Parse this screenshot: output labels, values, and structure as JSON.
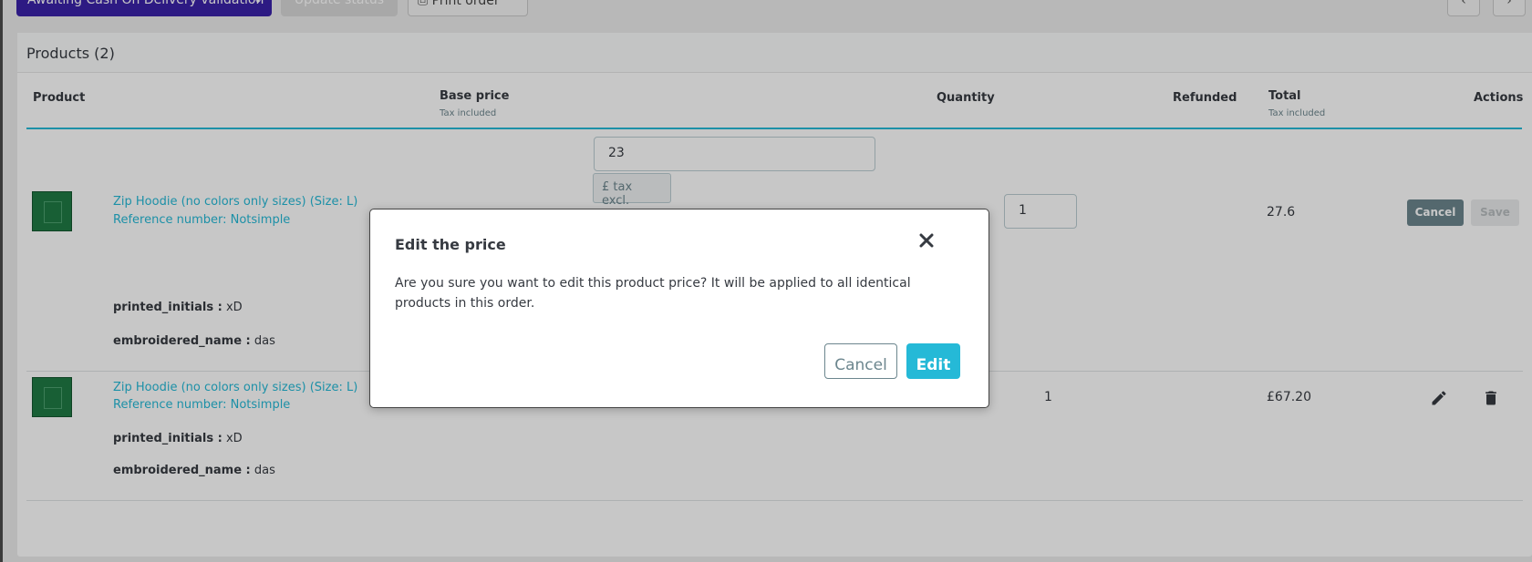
{
  "topbar": {
    "status_select": "Awaiting Cash On Delivery validation",
    "update_status": "Update status",
    "print_order": "Print order",
    "prev": "‹",
    "next": "›"
  },
  "products_card": {
    "title": "Products (2)",
    "columns": {
      "product": "Product",
      "base_price": "Base price",
      "base_price_sub": "Tax included",
      "quantity": "Quantity",
      "refunded": "Refunded",
      "total": "Total",
      "total_sub": "Tax included",
      "actions": "Actions"
    },
    "rows": [
      {
        "name": "Zip Hoodie (no colors only sizes) (Size: L)",
        "reference": "Reference number: Notsimple",
        "price_input": "23",
        "tax_addon": "£ tax excl.",
        "quantity_input": "1",
        "total": "27.6",
        "cancel": "Cancel",
        "save": "Save",
        "custom": [
          {
            "label": "printed_initials :",
            "value": "xD"
          },
          {
            "label": "embroidered_name :",
            "value": "das"
          }
        ]
      },
      {
        "name": "Zip Hoodie (no colors only sizes) (Size: L)",
        "reference": "Reference number: Notsimple",
        "quantity": "1",
        "total": "£67.20",
        "custom": [
          {
            "label": "printed_initials :",
            "value": "xD"
          },
          {
            "label": "embroidered_name :",
            "value": "das"
          }
        ]
      }
    ]
  },
  "modal": {
    "title": "Edit the price",
    "body": "Are you sure you want to edit this product price? It will be applied to all identical products in this order.",
    "cancel": "Cancel",
    "confirm": "Edit"
  },
  "colors": {
    "primary": "#25b9d7",
    "secondary": "#6c868e",
    "status": "#3a22a8"
  }
}
